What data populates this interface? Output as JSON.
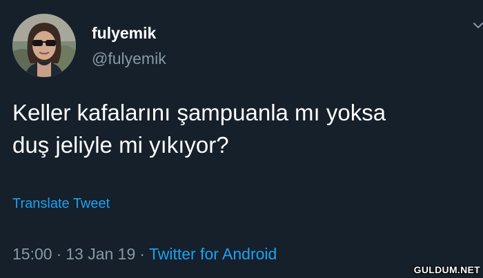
{
  "author": {
    "display_name": "fulyemik",
    "handle": "@fulyemik",
    "avatar_icon": "profile-photo"
  },
  "tweet": {
    "text_line1": "Keller kafalarını şampuanla mı yoksa",
    "text_line2": "duş jeliyle mi yıkıyor?",
    "translate_label": "Translate Tweet"
  },
  "meta": {
    "time": "15:00",
    "separator": "·",
    "date": "13 Jan 19",
    "source": "Twitter for Android"
  },
  "watermark": "GULDUM.NET",
  "colors": {
    "background": "#15202b",
    "text": "#ffffff",
    "secondary": "#8899a6",
    "accent": "#1da1f2"
  }
}
